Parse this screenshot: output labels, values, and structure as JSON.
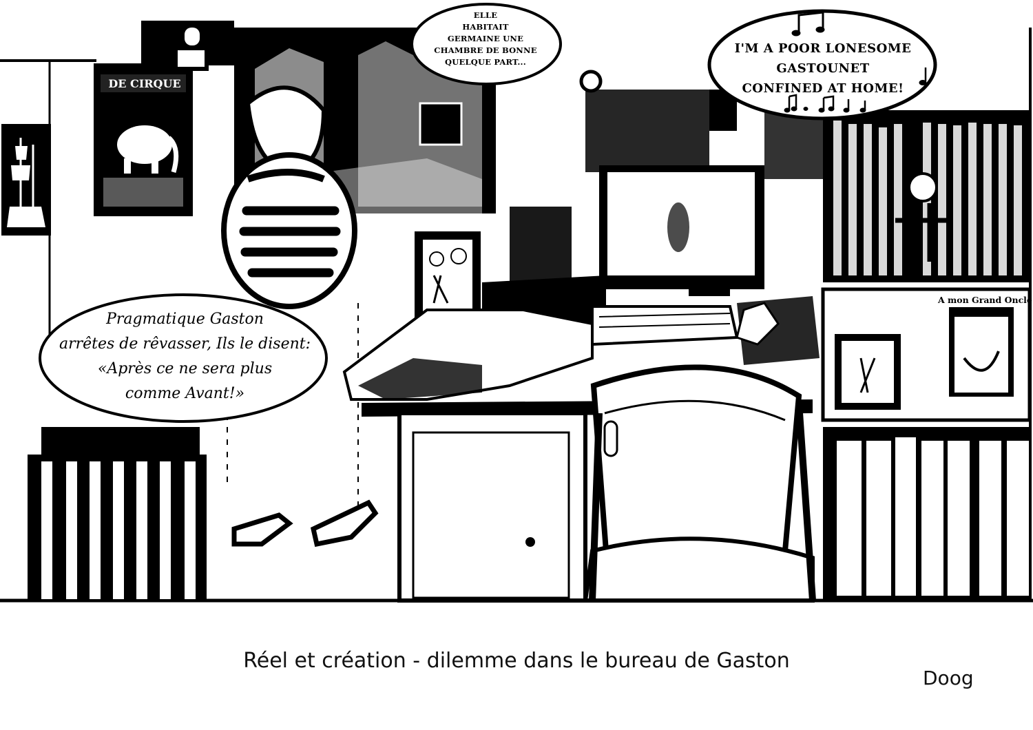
{
  "bubbles": {
    "elle": [
      "ELLE",
      "HABITAIT",
      "GERMAINE UNE",
      "CHAMBRE DE BONNE",
      "QUELQUE PART..."
    ],
    "gaston": [
      "I'M A POOR LONESOME",
      "GASTOUNET",
      "CONFINED AT HOME!"
    ],
    "pragmatique": [
      "Pragmatique Gaston",
      "arrêtes de rêvasser, Ils le disent:",
      "«Après ce ne sera plus",
      "comme Avant!»"
    ]
  },
  "scene_text": {
    "poster_title": "DE CIRQUE",
    "dedication": "A mon Grand Oncle"
  },
  "caption": "Réel et création - dilemme dans le bureau de Gaston",
  "author": "Doog",
  "colors": {
    "ink": "#000000",
    "paper": "#ffffff"
  }
}
